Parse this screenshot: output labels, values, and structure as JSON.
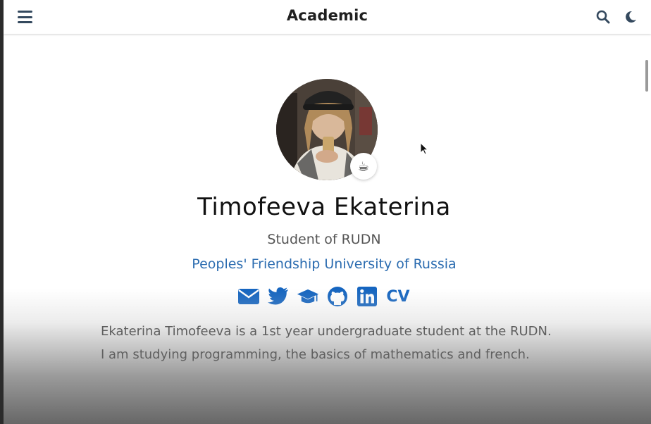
{
  "navbar": {
    "title": "Academic",
    "menu_icon": "hamburger-menu-icon",
    "search_icon": "search-icon",
    "theme_icon": "moon-icon"
  },
  "profile": {
    "status_emoji": "☕",
    "name": "Timofeeva Ekaterina",
    "role": "Student of RUDN",
    "organization": "Peoples' Friendship University of Russia",
    "socials": [
      {
        "icon": "envelope-icon"
      },
      {
        "icon": "twitter-icon"
      },
      {
        "icon": "graduation-cap-icon"
      },
      {
        "icon": "github-icon"
      },
      {
        "icon": "linkedin-icon"
      },
      {
        "label": "CV",
        "icon": "cv-icon"
      }
    ],
    "bio": "Ekaterina Timofeeva is a 1st year undergraduate student at the RUDN. I am studying programming, the basics of mathematics and french."
  },
  "colors": {
    "accent": "#1565c0",
    "org_link": "#2b6cb0",
    "nav_icon": "#34495e"
  }
}
